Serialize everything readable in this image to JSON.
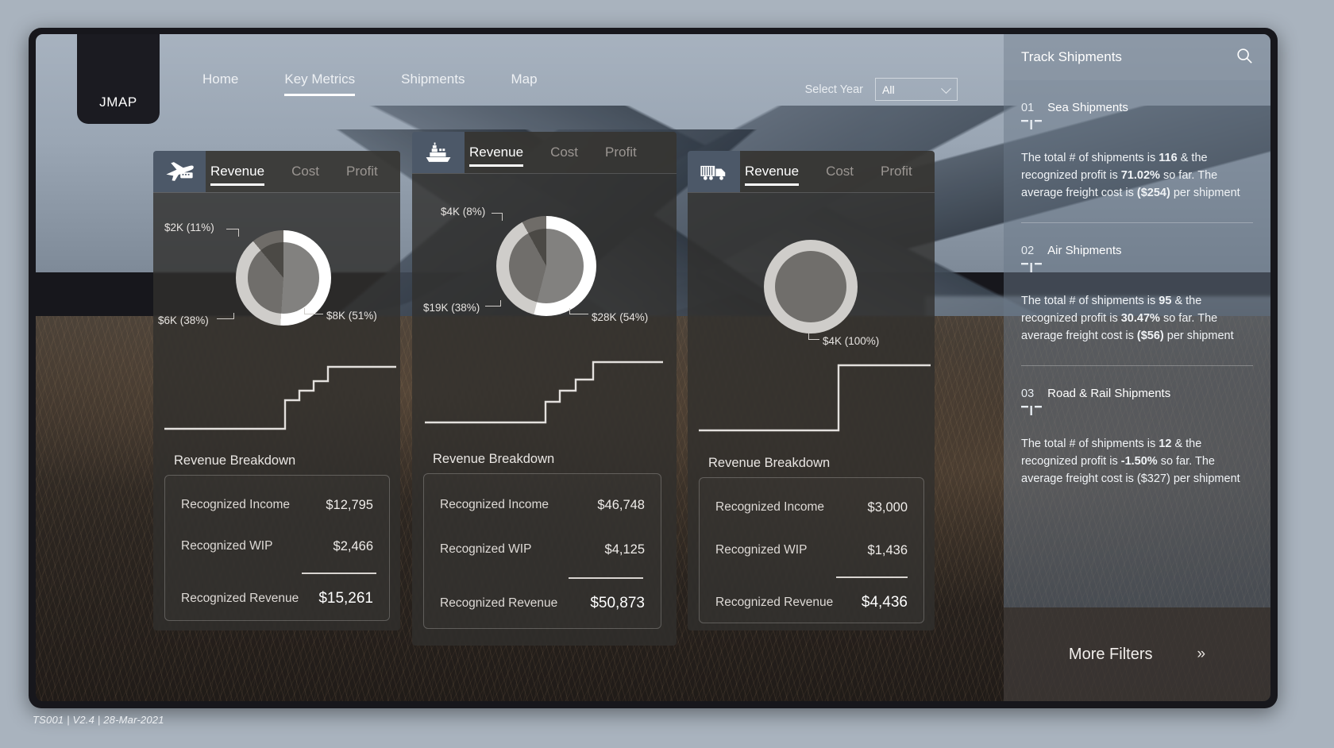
{
  "brand": {
    "logo": "JMAP"
  },
  "nav": {
    "items": [
      {
        "label": "Home",
        "active": false
      },
      {
        "label": "Key Metrics",
        "active": true
      },
      {
        "label": "Shipments",
        "active": false
      },
      {
        "label": "Map",
        "active": false
      }
    ]
  },
  "year_filter": {
    "label": "Select Year",
    "value": "All",
    "options": [
      "All"
    ]
  },
  "cards": [
    {
      "mode": "air",
      "icon": "airplane-icon",
      "tabs": [
        {
          "label": "Revenue",
          "active": true
        },
        {
          "label": "Cost",
          "active": false
        },
        {
          "label": "Profit",
          "active": false
        }
      ],
      "breakdown_title": "Revenue Breakdown",
      "rows": [
        {
          "label": "Recognized Income",
          "value": "$12,795"
        },
        {
          "label": "Recognized WIP",
          "value": "$2,466"
        }
      ],
      "total": {
        "label": "Recognized Revenue",
        "value": "$15,261"
      }
    },
    {
      "mode": "sea",
      "icon": "ship-icon",
      "tabs": [
        {
          "label": "Revenue",
          "active": true
        },
        {
          "label": "Cost",
          "active": false
        },
        {
          "label": "Profit",
          "active": false
        }
      ],
      "breakdown_title": "Revenue Breakdown",
      "rows": [
        {
          "label": "Recognized Income",
          "value": "$46,748"
        },
        {
          "label": "Recognized WIP",
          "value": "$4,125"
        }
      ],
      "total": {
        "label": "Recognized Revenue",
        "value": "$50,873"
      }
    },
    {
      "mode": "road",
      "icon": "truck-icon",
      "tabs": [
        {
          "label": "Revenue",
          "active": true
        },
        {
          "label": "Cost",
          "active": false
        },
        {
          "label": "Profit",
          "active": false
        }
      ],
      "breakdown_title": "Revenue Breakdown",
      "rows": [
        {
          "label": "Recognized Income",
          "value": "$3,000"
        },
        {
          "label": "Recognized WIP",
          "value": "$1,436"
        }
      ],
      "total": {
        "label": "Recognized Revenue",
        "value": "$4,436"
      }
    }
  ],
  "chart_data": [
    {
      "type": "pie",
      "title": "Air Revenue Breakdown",
      "labels": [
        "$8K (51%)",
        "$6K (38%)",
        "$2K (11%)"
      ],
      "values": [
        51,
        38,
        11
      ],
      "colors": [
        "#ffffff",
        "#cfcdca",
        "#6f6c68"
      ],
      "legend": "callout-labels"
    },
    {
      "type": "pie",
      "title": "Sea Revenue Breakdown",
      "labels": [
        "$28K (54%)",
        "$19K (38%)",
        "$4K (8%)"
      ],
      "values": [
        54,
        38,
        8
      ],
      "colors": [
        "#ffffff",
        "#cfcdca",
        "#6f6c68"
      ],
      "legend": "callout-labels"
    },
    {
      "type": "pie",
      "title": "Road & Rail Revenue Breakdown",
      "labels": [
        "$4K (100%)"
      ],
      "values": [
        100
      ],
      "colors": [
        "#cfcdca"
      ],
      "legend": "callout-labels"
    },
    {
      "type": "line",
      "title": "Air revenue trend",
      "x": [
        0,
        1,
        2,
        3,
        4,
        5,
        6,
        7,
        8
      ],
      "values": [
        8,
        8,
        8,
        46,
        52,
        62,
        70,
        82,
        82
      ],
      "step": true
    },
    {
      "type": "line",
      "title": "Sea revenue trend",
      "x": [
        0,
        1,
        2,
        3,
        4,
        5,
        6,
        7,
        8
      ],
      "values": [
        10,
        10,
        10,
        36,
        44,
        56,
        84,
        84,
        84
      ],
      "step": true
    },
    {
      "type": "line",
      "title": "Road & Rail revenue trend",
      "x": [
        0,
        1,
        2,
        3,
        4,
        5,
        6
      ],
      "values": [
        6,
        6,
        6,
        88,
        88,
        88,
        88
      ],
      "step": true
    }
  ],
  "donut_labels": {
    "air": [
      {
        "text": "$2K (11%)"
      },
      {
        "text": "$6K (38%)"
      },
      {
        "text": "$8K (51%)"
      }
    ],
    "sea": [
      {
        "text": "$4K (8%)"
      },
      {
        "text": "$19K (38%)"
      },
      {
        "text": "$28K (54%)"
      }
    ],
    "road": [
      {
        "text": "$4K (100%)"
      }
    ]
  },
  "track_panel": {
    "title": "Track Shipments",
    "search_icon": "search-icon",
    "items": [
      {
        "number": "01",
        "name": "Sea Shipments",
        "shipments": "116",
        "profit": "71.02%",
        "freight": "($254)",
        "text_1": "The total # of shipments is ",
        "text_2": " & the recognized profit  is ",
        "text_3": " so far. The average freight cost is ",
        "text_4": " per shipment"
      },
      {
        "number": "02",
        "name": "Air Shipments",
        "shipments": "95",
        "profit": "30.47%",
        "freight": "($56)",
        "text_1": "The total # of shipments is ",
        "text_2": " & the recognized profit  is ",
        "text_3": " so far. The average freight cost is ",
        "text_4": " per shipment"
      },
      {
        "number": "03",
        "name": "Road & Rail Shipments",
        "shipments": "12",
        "profit": "-1.50%",
        "freight": "($327)",
        "text_1": "The total # of shipments is ",
        "text_2": " & the recognized profit  is ",
        "text_3": " so far. The average freight cost is ",
        "text_4": " per shipment"
      }
    ],
    "more_filters": {
      "label": "More Filters",
      "chevron": "»"
    }
  },
  "footer": {
    "text": "TS001 | V2.4 | 28-Mar-2021"
  },
  "colors": {
    "accent_icon_bg": "#4c5868",
    "card_bg": "#312f2d",
    "panel_bg": "#6a7888",
    "segment_light": "#ffffff",
    "segment_mid": "#cfcdca",
    "segment_dark": "#6f6c68"
  }
}
